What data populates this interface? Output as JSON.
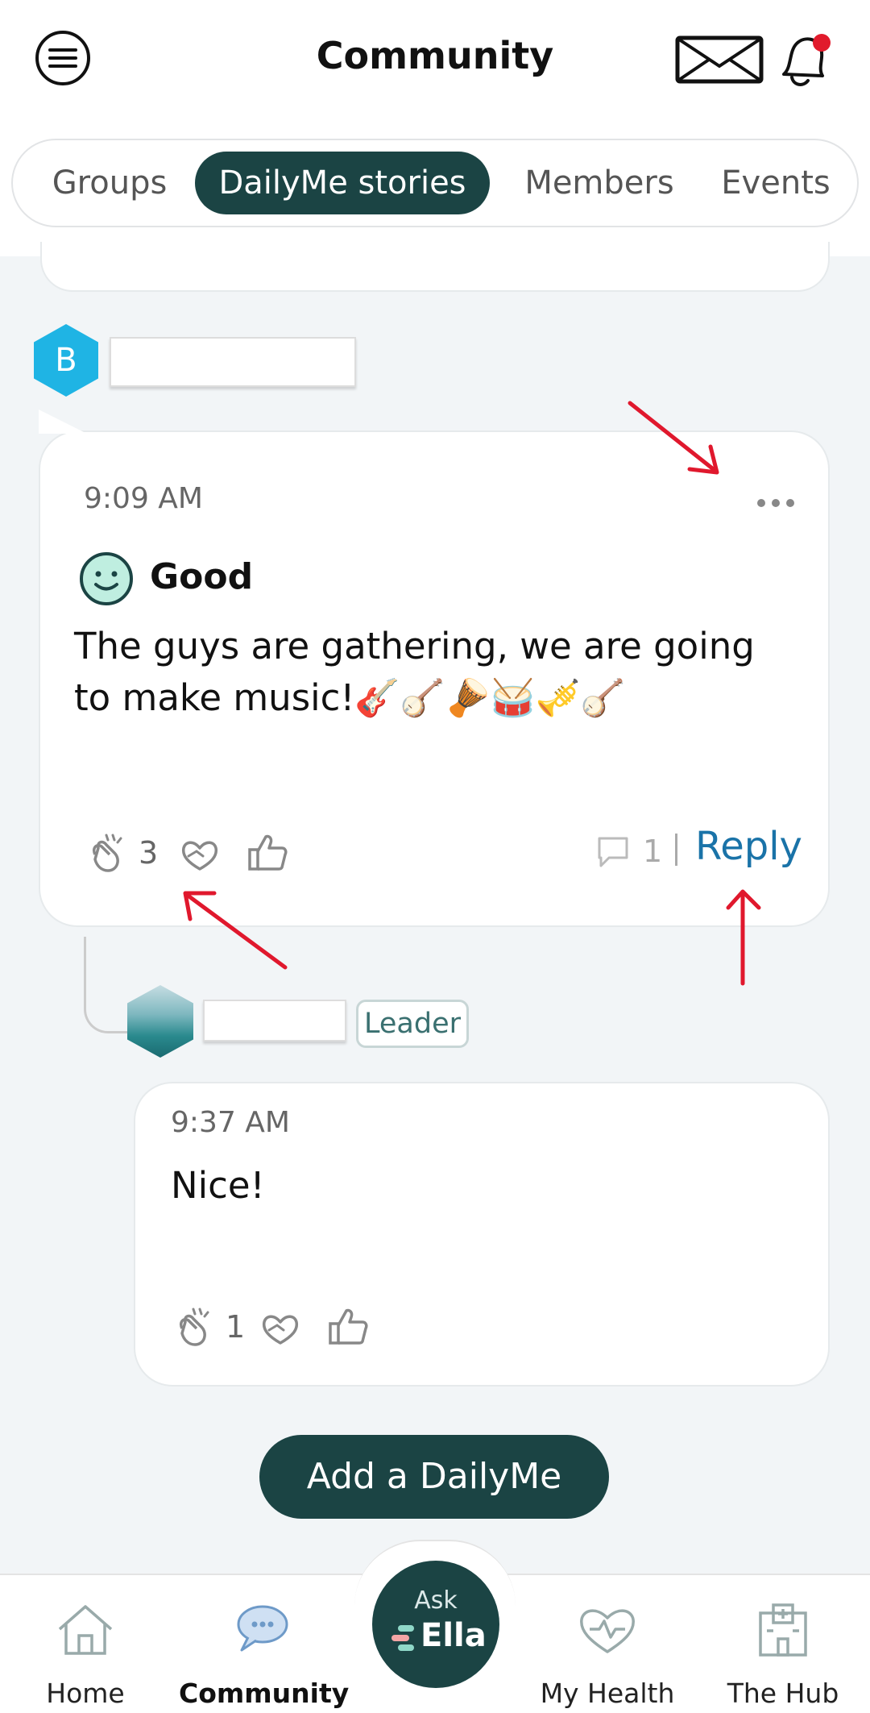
{
  "header": {
    "title": "Community",
    "notification_dot_color": "#e11b2c"
  },
  "tabs": [
    {
      "label": "Groups",
      "active": false
    },
    {
      "label": "DailyMe stories",
      "active": true
    },
    {
      "label": "Members",
      "active": false
    },
    {
      "label": "Events",
      "active": false
    }
  ],
  "post": {
    "avatar_letter": "B",
    "time": "9:09 AM",
    "mood": "Good",
    "text": "The guys are gathering, we are going to make music!🎸🪕🪘🥁🎺🪕",
    "clap_count": "3",
    "comment_count": "1",
    "reply_label": "Reply"
  },
  "reply": {
    "badge": "Leader",
    "time": "9:37 AM",
    "text": "Nice!",
    "clap_count": "1"
  },
  "add_button": "Add a DailyMe",
  "bottom_nav": {
    "home": "Home",
    "community": "Community",
    "ask_top": "Ask",
    "ask_bottom": "Ella",
    "my_health": "My Health",
    "the_hub": "The Hub"
  },
  "colors": {
    "primary": "#1b4444",
    "link": "#1a73a8",
    "avatar": "#1fb4e4"
  }
}
